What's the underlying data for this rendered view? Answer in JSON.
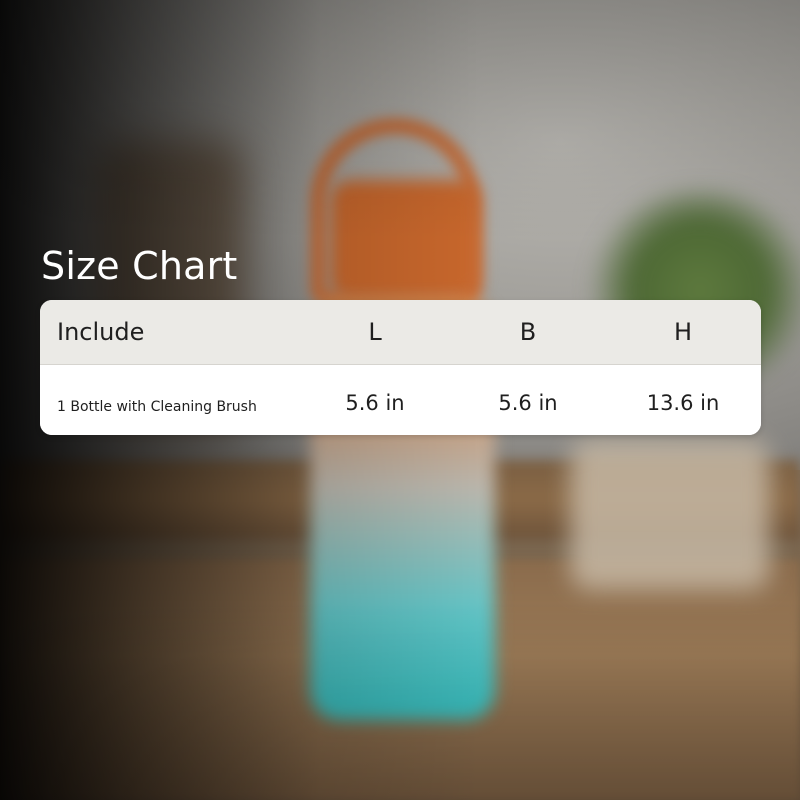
{
  "title": "Size Chart",
  "table": {
    "headers": [
      "Include",
      "L",
      "B",
      "H"
    ],
    "rows": [
      [
        "1 Bottle with Cleaning Brush",
        "5.6 in",
        "5.6 in",
        "13.6 in"
      ]
    ]
  },
  "colors": {
    "title_text": "#ffffff",
    "header_bg": "#ebeae6",
    "row_bg": "#ffffff",
    "cell_text": "#1f1f1f"
  }
}
